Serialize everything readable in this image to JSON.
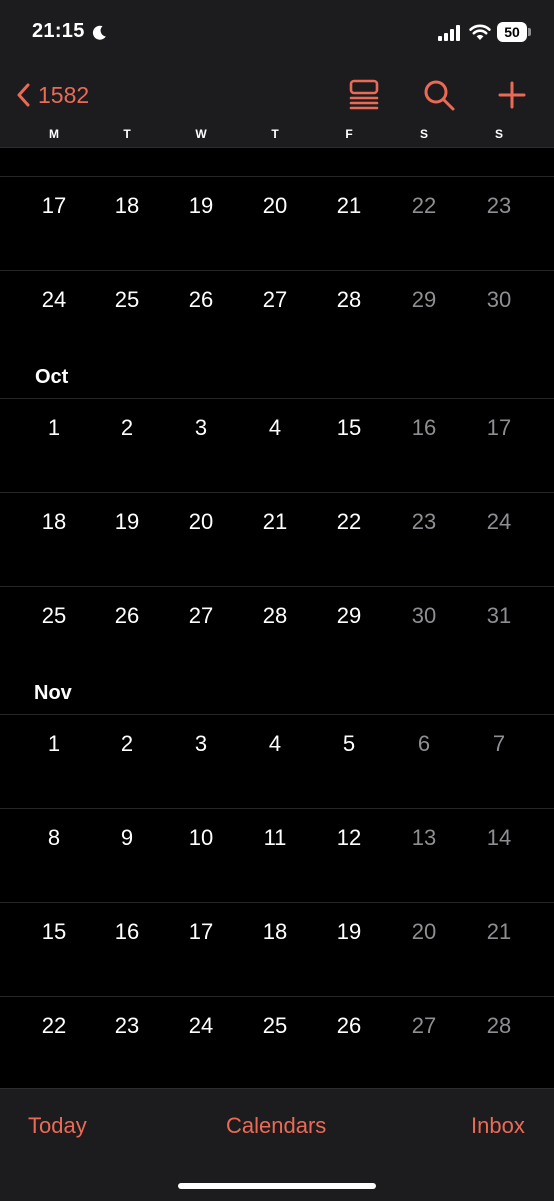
{
  "status_bar": {
    "time": "21:15",
    "battery_level": "50"
  },
  "nav": {
    "back_label": "1582",
    "icons": [
      "list-view-icon",
      "search-icon",
      "plus-icon"
    ],
    "weekdays": [
      "M",
      "T",
      "W",
      "T",
      "F",
      "S",
      "S"
    ]
  },
  "colors": {
    "accent": "#eb6a56",
    "background": "#000000",
    "bar_background": "#1c1c1e",
    "weekday_text": "#ffffff",
    "weekend_text": "#8e8e93"
  },
  "calendar": {
    "sections": [
      {
        "month": "",
        "weeks": [
          [
            "17",
            "18",
            "19",
            "20",
            "21",
            "22",
            "23"
          ],
          [
            "24",
            "25",
            "26",
            "27",
            "28",
            "29",
            "30"
          ]
        ]
      },
      {
        "month": "Oct",
        "weeks": [
          [
            "1",
            "2",
            "3",
            "4",
            "15",
            "16",
            "17"
          ],
          [
            "18",
            "19",
            "20",
            "21",
            "22",
            "23",
            "24"
          ],
          [
            "25",
            "26",
            "27",
            "28",
            "29",
            "30",
            "31"
          ]
        ]
      },
      {
        "month": "Nov",
        "weeks": [
          [
            "1",
            "2",
            "3",
            "4",
            "5",
            "6",
            "7"
          ],
          [
            "8",
            "9",
            "10",
            "11",
            "12",
            "13",
            "14"
          ],
          [
            "15",
            "16",
            "17",
            "18",
            "19",
            "20",
            "21"
          ],
          [
            "22",
            "23",
            "24",
            "25",
            "26",
            "27",
            "28"
          ]
        ]
      }
    ]
  },
  "toolbar": {
    "today_label": "Today",
    "calendars_label": "Calendars",
    "inbox_label": "Inbox"
  }
}
